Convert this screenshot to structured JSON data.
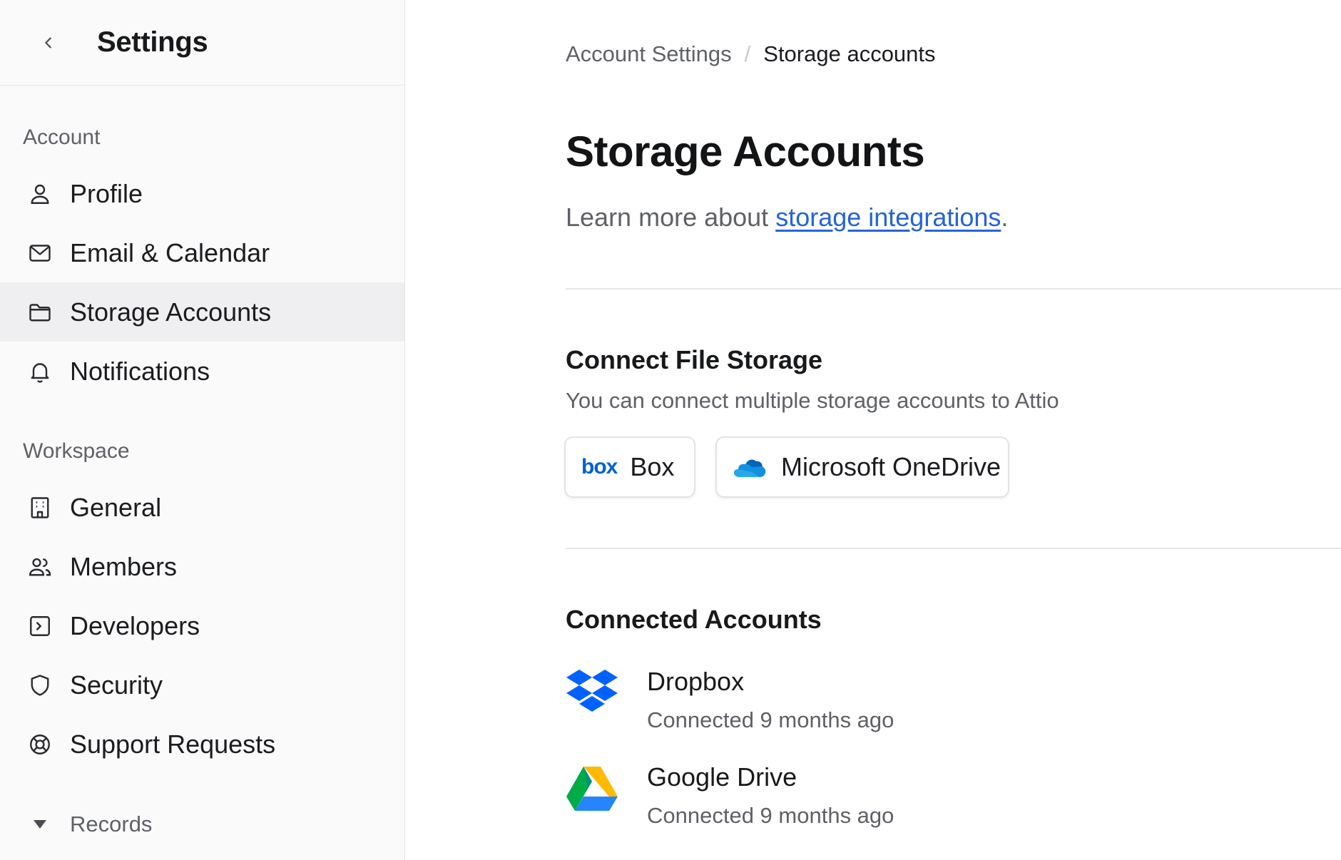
{
  "sidebar": {
    "title": "Settings",
    "account_section": {
      "label": "Account",
      "items": [
        {
          "label": "Profile",
          "icon": "user-icon"
        },
        {
          "label": "Email & Calendar",
          "icon": "mail-icon"
        },
        {
          "label": "Storage Accounts",
          "icon": "folder-icon",
          "active": true
        },
        {
          "label": "Notifications",
          "icon": "bell-icon"
        }
      ]
    },
    "workspace_section": {
      "label": "Workspace",
      "items": [
        {
          "label": "General",
          "icon": "building-icon"
        },
        {
          "label": "Members",
          "icon": "users-icon"
        },
        {
          "label": "Developers",
          "icon": "terminal-icon"
        },
        {
          "label": "Security",
          "icon": "shield-icon"
        },
        {
          "label": "Support Requests",
          "icon": "lifebuoy-icon"
        }
      ]
    },
    "records": {
      "label": "Records",
      "icon": "caret-down-icon"
    }
  },
  "breadcrumb": {
    "parent": "Account Settings",
    "separator": "/",
    "current": "Storage accounts"
  },
  "page": {
    "title": "Storage Accounts",
    "learn_prefix": "Learn more about ",
    "learn_link": "storage integrations",
    "learn_suffix": "."
  },
  "connect": {
    "heading": "Connect File Storage",
    "description": "You can connect multiple storage accounts to Attio",
    "providers": [
      {
        "logo_text": "box",
        "label": "Box",
        "icon": "box-logo-icon"
      },
      {
        "label": "Microsoft OneDrive",
        "icon": "onedrive-cloud-icon"
      }
    ]
  },
  "connected": {
    "heading": "Connected Accounts",
    "accounts": [
      {
        "name": "Dropbox",
        "status": "Connected 9 months ago",
        "icon": "dropbox-icon"
      },
      {
        "name": "Google Drive",
        "status": "Connected 9 months ago",
        "icon": "google-drive-icon"
      }
    ]
  },
  "colors": {
    "link": "#2563d9",
    "sidebar_bg": "#fafafa",
    "active_bg": "#efeff1",
    "box_brand": "#0061d5",
    "dropbox_brand": "#0061fe"
  }
}
